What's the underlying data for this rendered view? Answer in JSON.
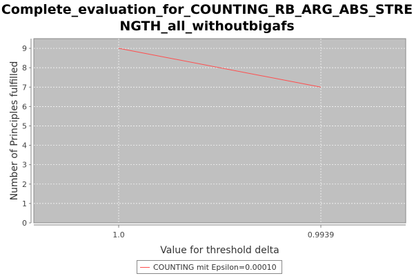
{
  "header": {
    "title_line1": "Complete_evaluation_for_COUNTING_RB_ARG_ABS_STRE",
    "title_line2": "NGTH_all_withoutbigafs"
  },
  "chart_data": {
    "type": "line",
    "title": "Complete_evaluation_for_COUNTING_RB_ARG_ABS_STRENGTH_all_withoutbigafs",
    "xlabel": "Value for threshold delta",
    "ylabel": "Number of Principles fulfilled",
    "categories": [
      "1.0",
      "0.9939"
    ],
    "series": [
      {
        "name": "COUNTING mit Epsilon=0.00010",
        "values": [
          9,
          7
        ],
        "color": "#ff4d4d"
      }
    ],
    "ylim": [
      0,
      9.5
    ],
    "yticks": [
      0,
      1,
      2,
      3,
      4,
      5,
      6,
      7,
      8,
      9
    ],
    "grid": true,
    "legend_position": "bottom-center",
    "plot_background": "#c0c0c0"
  }
}
